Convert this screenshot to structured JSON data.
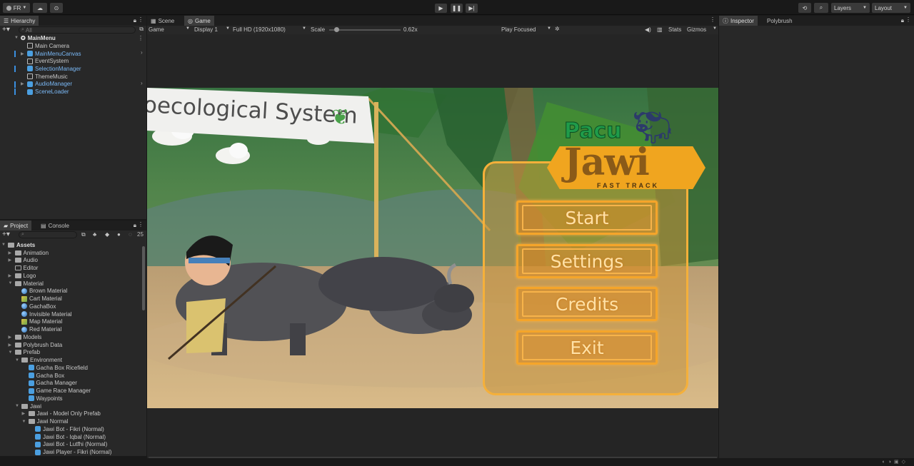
{
  "toolbar": {
    "account": "FR",
    "layers_label": "Layers",
    "layout_label": "Layout"
  },
  "hierarchy": {
    "tab": "Hierarchy",
    "search_placeholder": "All",
    "scene": "MainMenu",
    "items": [
      {
        "label": "Main Camera",
        "icon": "cube-outline-icon",
        "blue": false,
        "expand": false
      },
      {
        "label": "MainMenuCanvas",
        "icon": "cube-blue-icon",
        "blue": true,
        "expand": true
      },
      {
        "label": "EventSystem",
        "icon": "cube-outline-icon",
        "blue": false,
        "expand": false
      },
      {
        "label": "SelectionManager",
        "icon": "cube-blue-icon",
        "blue": true,
        "expand": false
      },
      {
        "label": "ThemeMusic",
        "icon": "cube-outline-icon",
        "blue": false,
        "expand": false
      },
      {
        "label": "AudioManager",
        "icon": "cube-blue-icon",
        "blue": true,
        "expand": true
      },
      {
        "label": "SceneLoader",
        "icon": "cube-blue-icon",
        "blue": true,
        "expand": false
      }
    ]
  },
  "project": {
    "tab_project": "Project",
    "tab_console": "Console",
    "count": "25",
    "tree": [
      {
        "label": "Assets",
        "depth": 0,
        "type": "folder",
        "open": true
      },
      {
        "label": "Animation",
        "depth": 1,
        "type": "folder",
        "arrow": true
      },
      {
        "label": "Audio",
        "depth": 1,
        "type": "folder",
        "arrow": true
      },
      {
        "label": "Editor",
        "depth": 1,
        "type": "folder-empty",
        "arrow": false
      },
      {
        "label": "Logo",
        "depth": 1,
        "type": "folder",
        "arrow": true
      },
      {
        "label": "Material",
        "depth": 1,
        "type": "folder",
        "open": true
      },
      {
        "label": "Brown Material",
        "depth": 2,
        "type": "sphere"
      },
      {
        "label": "Cart Material",
        "depth": 2,
        "type": "mat"
      },
      {
        "label": "GachaBox",
        "depth": 2,
        "type": "sphere"
      },
      {
        "label": "Invisible Material",
        "depth": 2,
        "type": "sphere"
      },
      {
        "label": "Map Material",
        "depth": 2,
        "type": "mat"
      },
      {
        "label": "Red Material",
        "depth": 2,
        "type": "sphere"
      },
      {
        "label": "Models",
        "depth": 1,
        "type": "folder",
        "arrow": true
      },
      {
        "label": "Polybrush Data",
        "depth": 1,
        "type": "folder",
        "arrow": true
      },
      {
        "label": "Prefab",
        "depth": 1,
        "type": "folder",
        "open": true
      },
      {
        "label": "Environment",
        "depth": 2,
        "type": "folder",
        "open": true
      },
      {
        "label": "Gacha Box Ricefield",
        "depth": 3,
        "type": "cube"
      },
      {
        "label": "Gacha Box",
        "depth": 3,
        "type": "cube"
      },
      {
        "label": "Gacha Manager",
        "depth": 3,
        "type": "cube"
      },
      {
        "label": "Game Race Manager",
        "depth": 3,
        "type": "cube"
      },
      {
        "label": "Waypoints",
        "depth": 3,
        "type": "cube"
      },
      {
        "label": "Jawi",
        "depth": 2,
        "type": "folder",
        "open": true
      },
      {
        "label": "Jawi - Model Only Prefab",
        "depth": 3,
        "type": "folder",
        "arrow": true
      },
      {
        "label": "Jawi Normal",
        "depth": 3,
        "type": "folder",
        "open": true
      },
      {
        "label": "Jawi Bot - Fikri (Normal)",
        "depth": 4,
        "type": "cube"
      },
      {
        "label": "Jawi Bot - Iqbal (Normal)",
        "depth": 4,
        "type": "cube"
      },
      {
        "label": "Jawi Bot - Lutfhi (Normal)",
        "depth": 4,
        "type": "cube"
      },
      {
        "label": "Jawi Player - Fikri (Normal)",
        "depth": 4,
        "type": "cube"
      }
    ]
  },
  "game_view": {
    "tab_scene": "Scene",
    "tab_game": "Game",
    "game_select": "Game",
    "display": "Display 1",
    "resolution": "Full HD (1920x1080)",
    "scale_label": "Scale",
    "scale_value": "0.62x",
    "scale_fraction": 0.1,
    "play_mode": "Play Focused",
    "stats": "Stats",
    "gizmos": "Gizmos"
  },
  "game": {
    "banner_text": "oecological System",
    "logo_top": "Pacu",
    "logo_main": "Jawi",
    "logo_sub": "FAST TRACK",
    "buttons": [
      "Start",
      "Settings",
      "Credits",
      "Exit"
    ]
  },
  "inspector": {
    "tab": "Inspector",
    "tab2": "Polybrush"
  },
  "colors": {
    "button_orange": "#f5a52a",
    "button_text": "#ffe1a6",
    "logo_green": "#1f9b4a",
    "link_blue": "#7ab8f5"
  }
}
